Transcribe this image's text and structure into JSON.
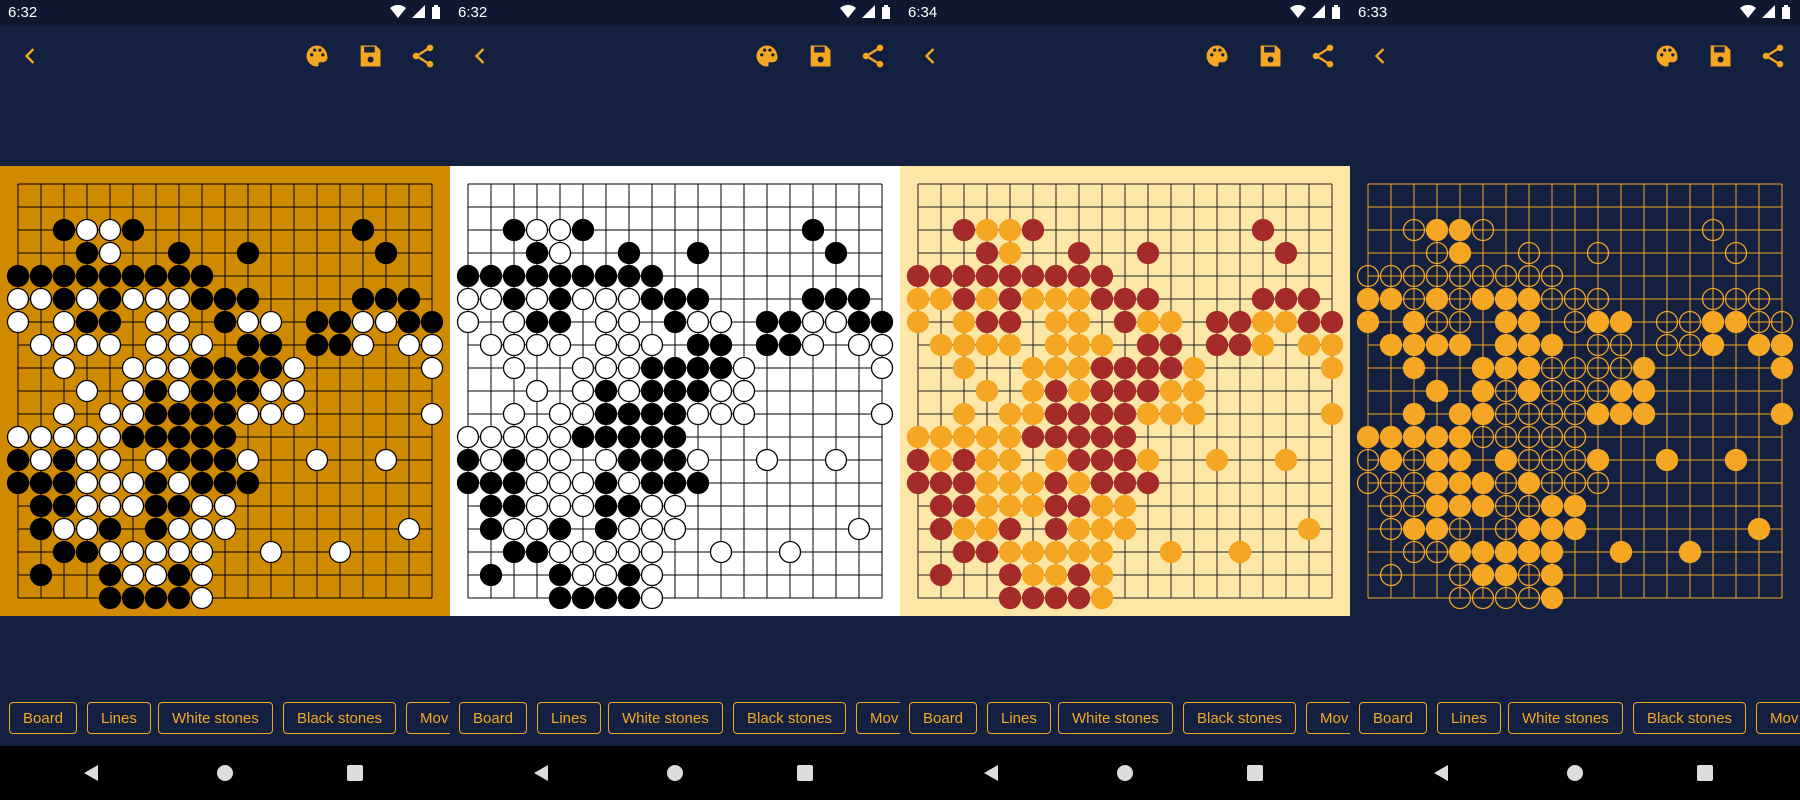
{
  "accent": "#f5a623",
  "toolbar_icons": [
    "back-arrow-icon",
    "palette-icon",
    "save-icon",
    "share-icon"
  ],
  "nav_icons": [
    "nav-back-icon",
    "nav-home-icon",
    "nav-recents-icon"
  ],
  "chips": [
    "Board",
    "Lines",
    "White stones",
    "Black stones",
    "Mov"
  ],
  "screens": [
    {
      "time": "6:32",
      "theme": {
        "bg": "#d08a00",
        "boardBg": "#d08a00",
        "line": "#000000",
        "black": "#000000",
        "blackStroke": "#000000",
        "white": "#ffffff",
        "whiteStroke": "#000000",
        "frameFull": true
      }
    },
    {
      "time": "6:32",
      "theme": {
        "bg": "#ffffff",
        "boardBg": "#ffffff",
        "line": "#000000",
        "black": "#000000",
        "blackStroke": "#000000",
        "white": "#ffffff",
        "whiteStroke": "#000000",
        "frameFull": true
      }
    },
    {
      "time": "6:34",
      "theme": {
        "bg": "#fde7a6",
        "boardBg": "#fde7a6",
        "line": "#222222",
        "black": "#a52a2a",
        "blackStroke": "#a52a2a",
        "white": "#f5a623",
        "whiteStroke": "#f5a623",
        "frameFull": true
      }
    },
    {
      "time": "6:33",
      "theme": {
        "bg": "#142040",
        "boardBg": "#142040",
        "line": "#f5a623",
        "black": "none",
        "blackStroke": "#f5a623",
        "white": "#f5a623",
        "whiteStroke": "#f5a623",
        "frameFull": false
      }
    }
  ],
  "board": {
    "size": 19,
    "rows": [
      ".......................",
      "...................",
      "..BWWB.........B...",
      "...BW..B..B.....B..",
      "BBBBBBBBB..........",
      "WWBWBWWWBBB....BBB.",
      "W.WBB.WW.BWW.BBWWBB",
      ".WWWW.WWW.BB.BBW.WW",
      "..W..WWWBBBBW.....W",
      "...W.WBWBBBWW......",
      "..W.WWBBBBWWW.....W",
      "WWWWWBBBBB.........",
      "BWBWW.WBBBW..W..W..",
      "BBBWWWBWBBB........",
      ".BBWWWBBWW.........",
      ".BWWB.BWWW.......W.",
      "..BBWWWWW..W..W....",
      ".B..BWWBW..........",
      "....BBBBW.........."
    ]
  },
  "status": {
    "wifi": "wifi-icon",
    "signal": "signal-icon",
    "battery": "battery-icon"
  }
}
